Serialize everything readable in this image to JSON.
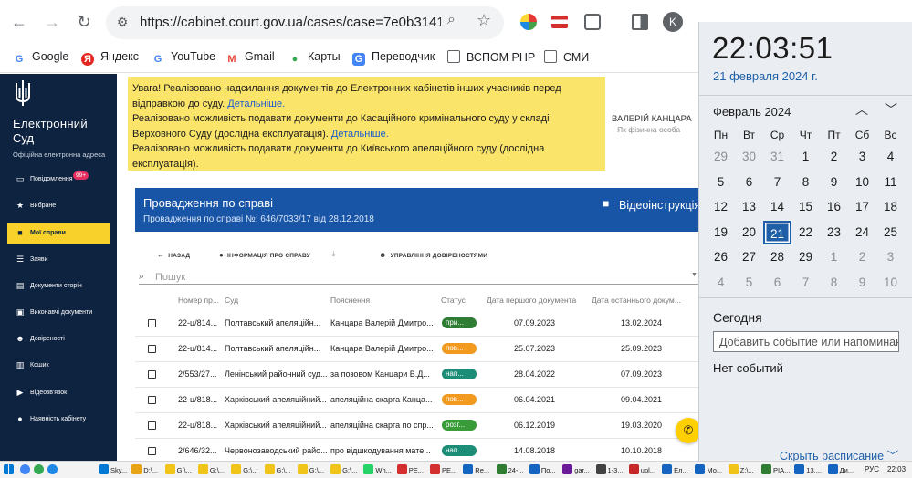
{
  "browser": {
    "url": "https://cabinet.court.gov.ua/cases/case=7e0b3141b7...",
    "profile_initial": "K",
    "bookmarks": [
      "Google",
      "Яндекс",
      "YouTube",
      "Gmail",
      "Карты",
      "Переводчик",
      "ВСПОМ РНР",
      "СМИ"
    ],
    "colors": {
      "accent": "#1855a7",
      "sidebar": "#0e2340",
      "highlight": "#f8d22a"
    }
  },
  "sidebar": {
    "brand_line1": "Електронний",
    "brand_line2": "Суд",
    "brand_sub": "Офіційна електронна адреса",
    "notifications_badge": "99+",
    "items": [
      {
        "label": "Повідомлення",
        "icon": "message-icon"
      },
      {
        "label": "Вибране",
        "icon": "star-icon"
      },
      {
        "label": "Мої справи",
        "icon": "folder-icon"
      },
      {
        "label": "Заяви",
        "icon": "list-icon"
      },
      {
        "label": "Документи сторін",
        "icon": "documents-icon"
      },
      {
        "label": "Виконавчі документи",
        "icon": "archive-icon"
      },
      {
        "label": "Довіреності",
        "icon": "people-icon"
      },
      {
        "label": "Кошик",
        "icon": "trash-icon"
      },
      {
        "label": "Відеозв'язок",
        "icon": "video-icon"
      },
      {
        "label": "Наявність кабінету",
        "icon": "person-icon"
      }
    ]
  },
  "notice": {
    "line1": "Увага! Реалізовано надсилання документів до Електронних кабінетів інших учасників перед відправкою до суду.",
    "link1": "Детальніше.",
    "line2": "Реалізовано можливість подавати документи до Касаційного кримінального суду у складі Верховного Суду (дослідна експлуатація).",
    "link2": "Детальніше.",
    "line3": "Реалізовано можливість подавати документи до Київського апеляційного суду (дослідна експлуатація)."
  },
  "user": {
    "name": "ВАЛЕРІЙ КАНЦАРА",
    "role": "Як фізична особа"
  },
  "case": {
    "title": "Провадження по справі",
    "subtitle": "Провадження по справі №: 646/7033/17 від 28.12.2018",
    "video_label": "Відеоінструкція"
  },
  "toolbar": {
    "back": "НАЗАД",
    "info": "ІНФОРМАЦІЯ ПРО СПРАВУ",
    "trust": "УПРАВЛІННЯ ДОВІРЕНОСТЯМИ"
  },
  "search": {
    "placeholder": "Пошук"
  },
  "table": {
    "headers": [
      "Номер пр...",
      "Суд",
      "Пояснення",
      "Статус",
      "Дата першого документа",
      "Дата останнього докум..."
    ],
    "rows": [
      {
        "number": "22-ц/814...",
        "court": "Полтавський апеляційн...",
        "desc": "Канцара Валерій Дмитро...",
        "status": "при...",
        "status_color": "#2e7d32",
        "first": "07.09.2023",
        "last": "13.02.2024"
      },
      {
        "number": "22-ц/814...",
        "court": "Полтавський апеляційн...",
        "desc": "Канцара Валерій Дмитро...",
        "status": "пов...",
        "status_color": "#f29a1f",
        "first": "25.07.2023",
        "last": "25.09.2023"
      },
      {
        "number": "2/553/27...",
        "court": "Ленінський районний суд...",
        "desc": "за позовом Канцари В.Д...",
        "status": "нап...",
        "status_color": "#1c8d76",
        "first": "28.04.2022",
        "last": "07.09.2023"
      },
      {
        "number": "22-ц/818...",
        "court": "Харківський апеляційний...",
        "desc": "апеляційна скарга Канца...",
        "status": "пов...",
        "status_color": "#f29a1f",
        "first": "06.04.2021",
        "last": "09.04.2021"
      },
      {
        "number": "22-ц/818...",
        "court": "Харківський апеляційний...",
        "desc": "апеляційна скарга по спр...",
        "status": "розг...",
        "status_color": "#3a9c39",
        "first": "06.12.2019",
        "last": "19.03.2020"
      },
      {
        "number": "2/646/32...",
        "court": "Червонозаводський райо...",
        "desc": "про відшкодування мате...",
        "status": "нап...",
        "status_color": "#1c8d76",
        "first": "14.08.2018",
        "last": "10.10.2018"
      }
    ]
  },
  "calendar": {
    "time": "22:03:51",
    "date": "21 февраля 2024 г.",
    "month": "Февраль 2024",
    "weekdays": [
      "Пн",
      "Вт",
      "Ср",
      "Чт",
      "Пт",
      "Сб",
      "Вс"
    ],
    "weeks": [
      [
        29,
        30,
        31,
        1,
        2,
        3,
        4
      ],
      [
        5,
        6,
        7,
        8,
        9,
        10,
        11
      ],
      [
        12,
        13,
        14,
        15,
        16,
        17,
        18
      ],
      [
        19,
        20,
        21,
        22,
        23,
        24,
        25
      ],
      [
        26,
        27,
        28,
        29,
        1,
        2,
        3
      ],
      [
        4,
        5,
        6,
        7,
        8,
        9,
        10
      ]
    ],
    "today": 21,
    "today_title": "Сегодня",
    "event_placeholder": "Добавить событие или напоминан",
    "no_events": "Нет событий",
    "hide_schedule": "Скрыть расписание"
  },
  "taskbar": {
    "items": [
      "Sky...",
      "D:\\...",
      "G:\\...",
      "G:\\...",
      "G:\\...",
      "G:\\...",
      "G:\\...",
      "G:\\...",
      "Wh...",
      "PE...",
      "PE...",
      "Re...",
      "24-...",
      "По...",
      "gar...",
      "1-3...",
      "upl...",
      "Ел...",
      "Мо...",
      "Z:\\...",
      "PIA...",
      "13....",
      "Ди..."
    ],
    "lang": "РУС",
    "clock": "22:03"
  }
}
